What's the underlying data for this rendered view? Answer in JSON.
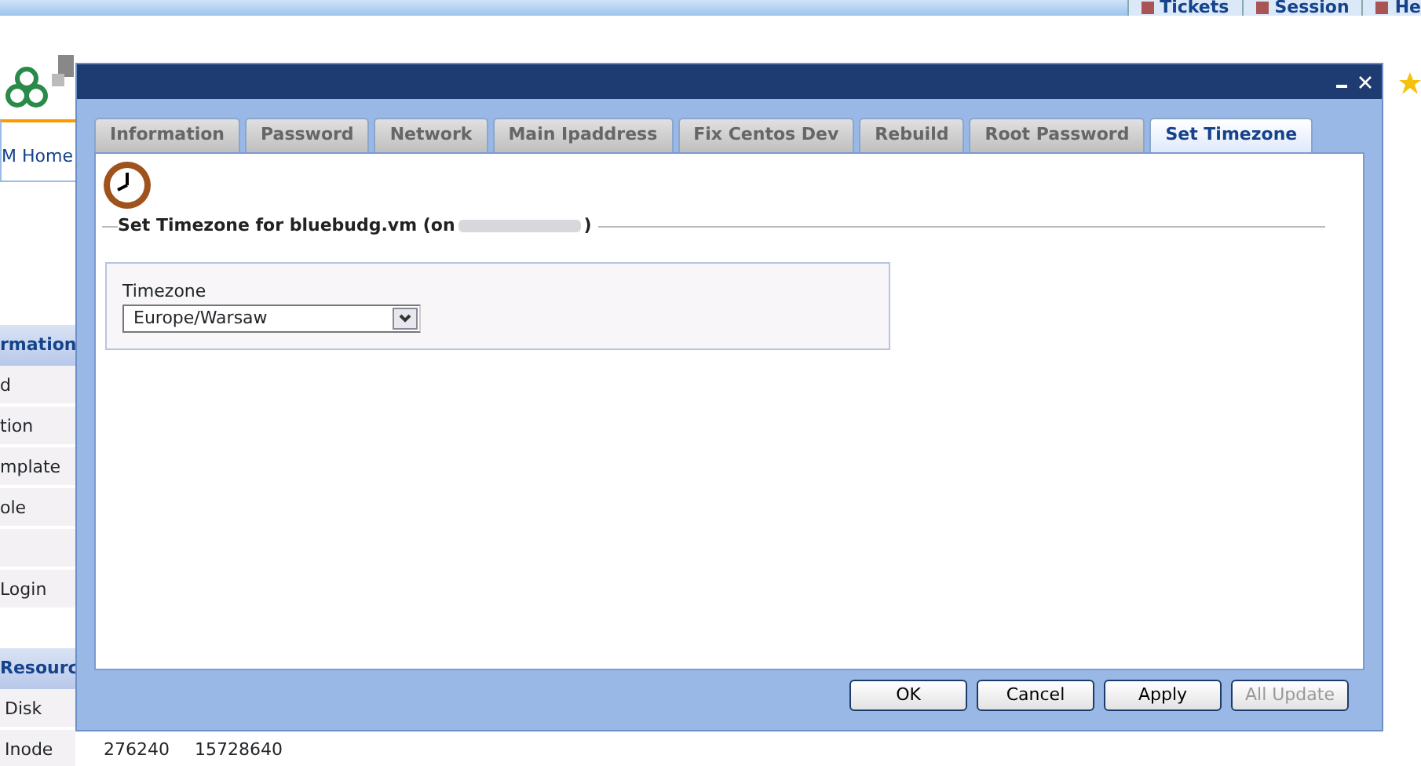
{
  "top_tabs": [
    {
      "label": "Tickets"
    },
    {
      "label": "Session"
    },
    {
      "label": "He"
    }
  ],
  "page_tab": {
    "label": "M Home"
  },
  "sidebar": {
    "section_1": "rmation",
    "rows": [
      "d",
      "tion",
      "mplate",
      "ole",
      "",
      "Login"
    ],
    "section_2": "Resourc",
    "resource_rows": [
      {
        "label": "Disk",
        "cells": []
      },
      {
        "label": "Inode",
        "cells": [
          "276240",
          "15728640"
        ]
      }
    ]
  },
  "dialog": {
    "tabs": [
      {
        "label": "Information",
        "selected": false
      },
      {
        "label": "Password",
        "selected": false
      },
      {
        "label": "Network",
        "selected": false
      },
      {
        "label": "Main Ipaddress",
        "selected": false
      },
      {
        "label": "Fix Centos Dev",
        "selected": false
      },
      {
        "label": "Rebuild",
        "selected": false
      },
      {
        "label": "Root Password",
        "selected": false
      },
      {
        "label": "Set Timezone",
        "selected": true
      }
    ],
    "heading": "Set Timezone for bluebudg.vm (on",
    "heading_end": ")",
    "field": {
      "label": "Timezone",
      "value": "Europe/Warsaw"
    },
    "buttons": [
      {
        "label": "OK",
        "disabled": false
      },
      {
        "label": "Cancel",
        "disabled": false
      },
      {
        "label": "Apply",
        "disabled": false
      },
      {
        "label": "All Update",
        "disabled": true
      }
    ]
  }
}
